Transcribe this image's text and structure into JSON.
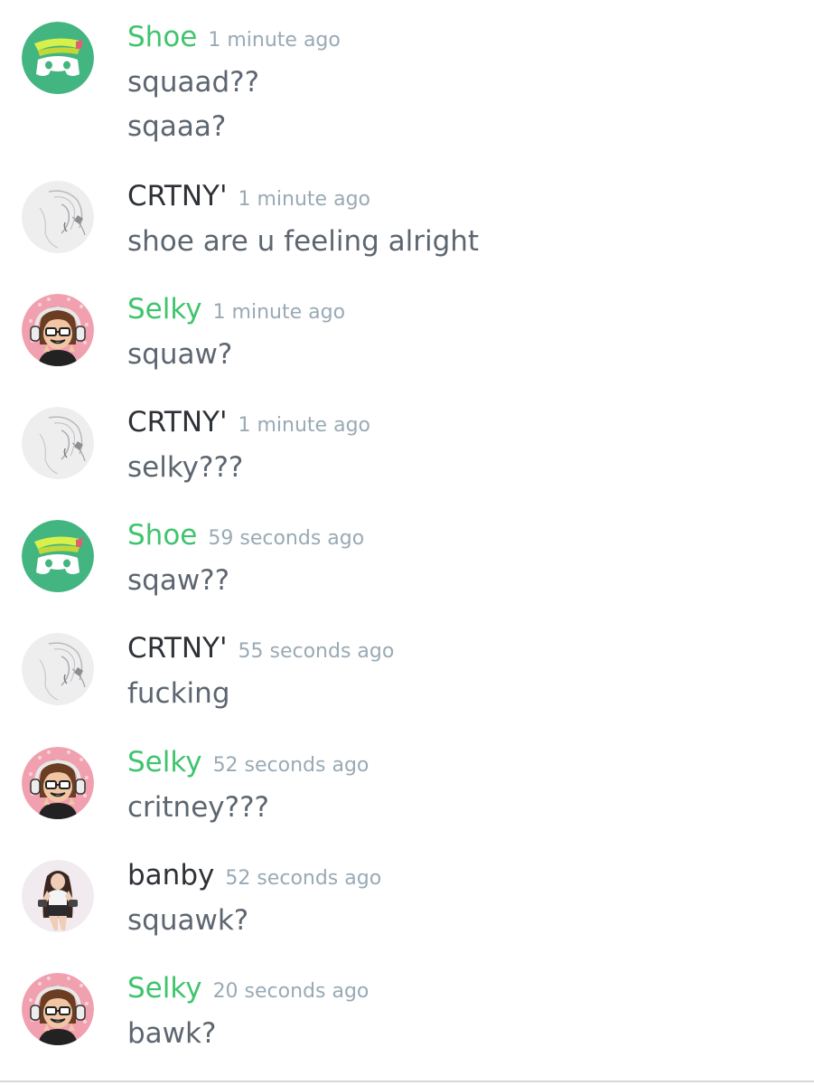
{
  "colors": {
    "green_user": "#3fc46e",
    "dark_user": "#2e3136",
    "timestamp": "#99aab5",
    "message_text": "#5d6670",
    "discord_green": "#43b581"
  },
  "messages": [
    {
      "username": "Shoe",
      "user_color": "#3fc46e",
      "avatar": "discord-visor-avatar-icon",
      "timestamp": "1 minute ago",
      "lines": [
        "squaad??",
        "sqaaa?"
      ]
    },
    {
      "username": "CRTNY'",
      "user_color": "#2e3136",
      "avatar": "sketch-portrait-avatar-icon",
      "timestamp": "1 minute ago",
      "lines": [
        "shoe are u feeling alright"
      ]
    },
    {
      "username": "Selky",
      "user_color": "#3fc46e",
      "avatar": "headphones-girl-avatar-icon",
      "timestamp": "1 minute ago",
      "lines": [
        "squaw?"
      ]
    },
    {
      "username": "CRTNY'",
      "user_color": "#2e3136",
      "avatar": "sketch-portrait-avatar-icon",
      "timestamp": "1 minute ago",
      "lines": [
        "selky???"
      ]
    },
    {
      "username": "Shoe",
      "user_color": "#3fc46e",
      "avatar": "discord-visor-avatar-icon",
      "timestamp": "59 seconds ago",
      "lines": [
        "sqaw??"
      ]
    },
    {
      "username": "CRTNY'",
      "user_color": "#2e3136",
      "avatar": "sketch-portrait-avatar-icon",
      "timestamp": "55 seconds ago",
      "lines": [
        "fucking"
      ]
    },
    {
      "username": "Selky",
      "user_color": "#3fc46e",
      "avatar": "headphones-girl-avatar-icon",
      "timestamp": "52 seconds ago",
      "lines": [
        "critney???"
      ]
    },
    {
      "username": "banby",
      "user_color": "#2e3136",
      "avatar": "anime-character-avatar-icon",
      "timestamp": "52 seconds ago",
      "lines": [
        "squawk?"
      ]
    },
    {
      "username": "Selky",
      "user_color": "#3fc46e",
      "avatar": "headphones-girl-avatar-icon",
      "timestamp": "20 seconds ago",
      "lines": [
        "bawk?"
      ]
    }
  ]
}
